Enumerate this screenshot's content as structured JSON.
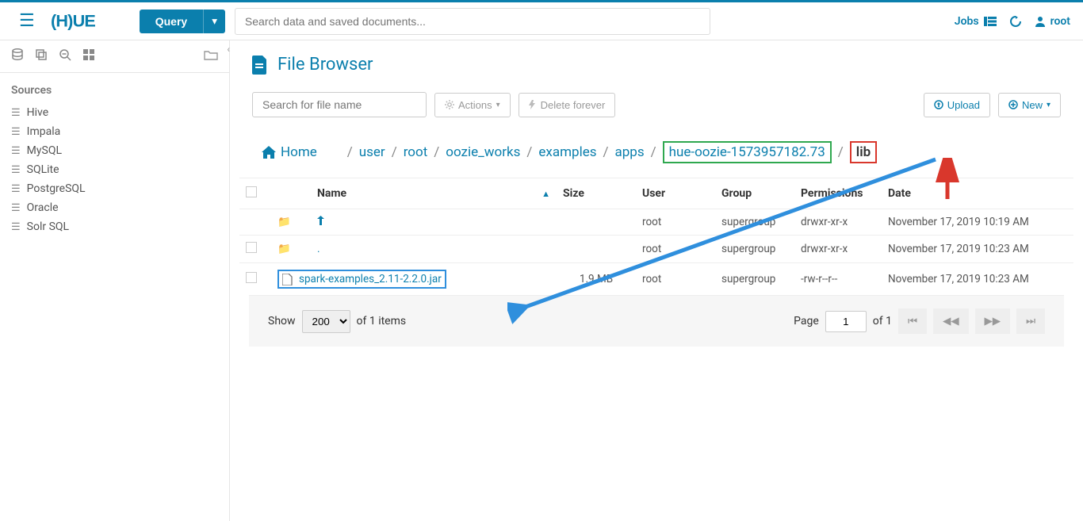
{
  "topbar": {
    "query_label": "Query",
    "search_placeholder": "Search data and saved documents...",
    "jobs_label": "Jobs",
    "user_label": "root"
  },
  "sidebar": {
    "section_title": "Sources",
    "items": [
      {
        "label": "Hive"
      },
      {
        "label": "Impala"
      },
      {
        "label": "MySQL"
      },
      {
        "label": "SQLite"
      },
      {
        "label": "PostgreSQL"
      },
      {
        "label": "Oracle"
      },
      {
        "label": "Solr SQL"
      }
    ]
  },
  "page": {
    "title": "File Browser"
  },
  "toolbar": {
    "search_placeholder": "Search for file name",
    "actions_label": "Actions",
    "delete_label": "Delete forever",
    "upload_label": "Upload",
    "new_label": "New"
  },
  "breadcrumb": {
    "home": "Home",
    "parts": [
      "user",
      "root",
      "oozie_works",
      "examples",
      "apps"
    ],
    "highlighted": "hue-oozie-1573957182.73",
    "current": "lib"
  },
  "table": {
    "headers": {
      "name": "Name",
      "size": "Size",
      "user": "User",
      "group": "Group",
      "permissions": "Permissions",
      "date": "Date"
    },
    "rows": [
      {
        "type": "folder-up",
        "name": "",
        "size": "",
        "user": "root",
        "group": "supergroup",
        "permissions": "drwxr-xr-x",
        "date": "November 17, 2019 10:19 AM"
      },
      {
        "type": "folder",
        "name": ".",
        "size": "",
        "user": "root",
        "group": "supergroup",
        "permissions": "drwxr-xr-x",
        "date": "November 17, 2019 10:23 AM"
      },
      {
        "type": "file",
        "name": "spark-examples_2.11-2.2.0.jar",
        "size": "1.9 MB",
        "user": "root",
        "group": "supergroup",
        "permissions": "-rw-r--r--",
        "date": "November 17, 2019 10:23 AM"
      }
    ]
  },
  "pager": {
    "show_label": "Show",
    "show_value": "200",
    "of_items": "of 1 items",
    "page_label": "Page",
    "page_value": "1",
    "page_total": "of 1"
  }
}
